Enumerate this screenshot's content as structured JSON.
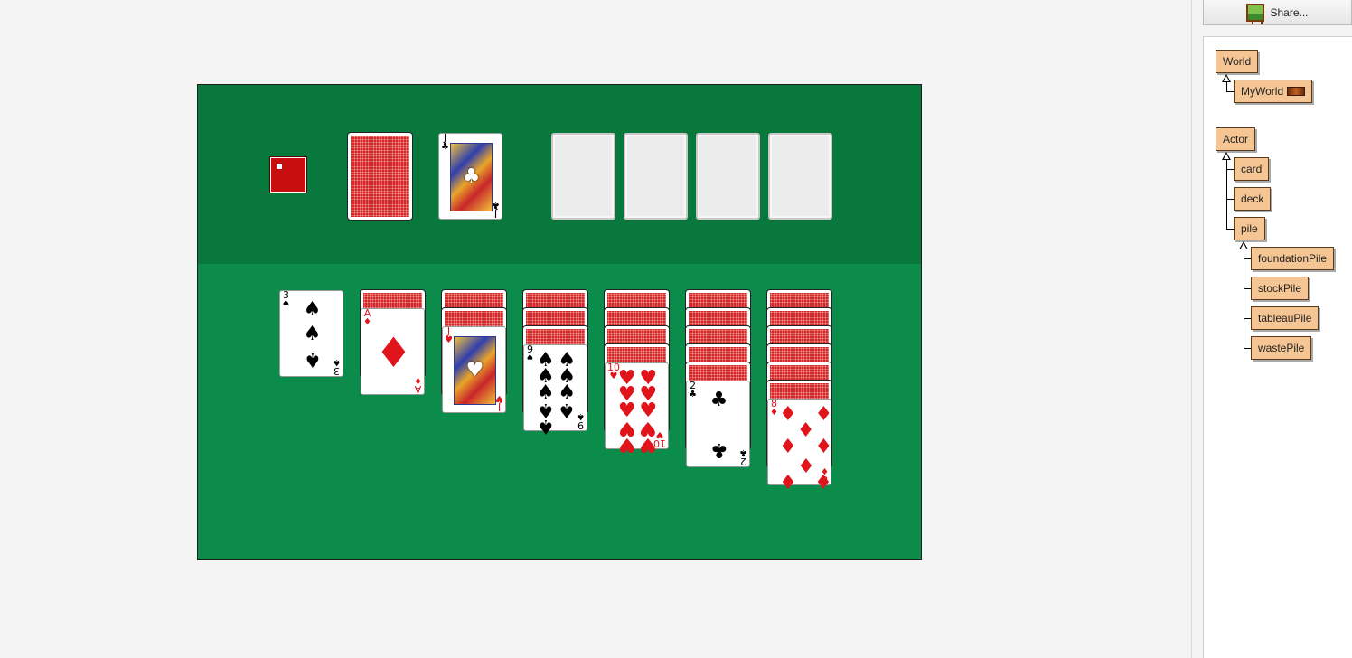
{
  "toolbar": {
    "share_label": "Share..."
  },
  "class_tree": {
    "world_root": "World",
    "world_sub": "MyWorld",
    "actor_root": "Actor",
    "actor_subs": [
      "card",
      "deck",
      "pile"
    ],
    "pile_subs": [
      "foundationPile",
      "stockPile",
      "tableauPile",
      "wastePile"
    ]
  },
  "game": {
    "waste_card": {
      "rank": "J",
      "suit": "♣",
      "color": "black"
    },
    "tableau": [
      {
        "hidden": 0,
        "card": {
          "rank": "3",
          "suit": "♠",
          "color": "black",
          "pips": 3
        }
      },
      {
        "hidden": 1,
        "card": {
          "rank": "A",
          "suit": "♦",
          "color": "red",
          "pips": 1
        }
      },
      {
        "hidden": 2,
        "card": {
          "rank": "J",
          "suit": "♥",
          "color": "red",
          "pips": 0
        }
      },
      {
        "hidden": 3,
        "card": {
          "rank": "9",
          "suit": "♠",
          "color": "black",
          "pips": 9
        }
      },
      {
        "hidden": 4,
        "card": {
          "rank": "10",
          "suit": "♥",
          "color": "red",
          "pips": 10
        }
      },
      {
        "hidden": 5,
        "card": {
          "rank": "2",
          "suit": "♣",
          "color": "black",
          "pips": 2
        }
      },
      {
        "hidden": 6,
        "card": {
          "rank": "8",
          "suit": "♦",
          "color": "red",
          "pips": 8
        }
      }
    ]
  },
  "colors": {
    "table_top": "#08783c",
    "table_bottom": "#0b8c4a",
    "card_back": "#d21a1a",
    "class_box": "#f5c593"
  }
}
